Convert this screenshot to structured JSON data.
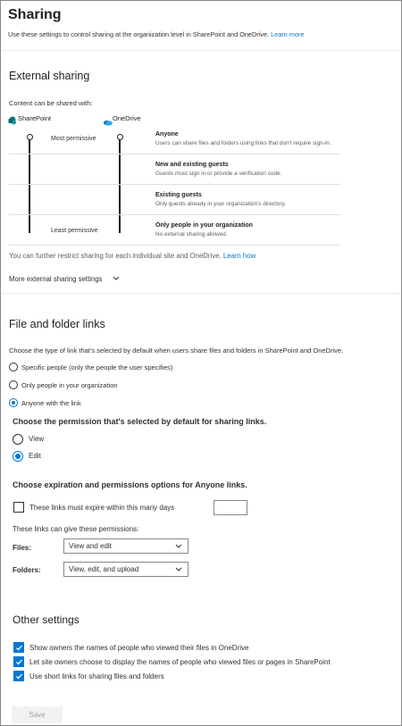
{
  "header": {
    "title": "Sharing",
    "subtitle": "Use these settings to control sharing at the organization level in SharePoint and OneDrive.",
    "learn_more": "Learn more"
  },
  "external": {
    "title": "External sharing",
    "intro": "Content can be shared with:",
    "sharepoint_label": "SharePoint",
    "onedrive_label": "OneDrive",
    "most_permissive": "Most permissive",
    "least_permissive": "Least permissive",
    "sharepoint_level": "Anyone",
    "onedrive_level": "Anyone",
    "levels": [
      {
        "title": "Anyone",
        "desc": "Users can share files and folders using links that don't require sign-in."
      },
      {
        "title": "New and existing guests",
        "desc": "Guests must sign in or provide a verification code."
      },
      {
        "title": "Existing guests",
        "desc": "Only guests already in your organization's directory."
      },
      {
        "title": "Only people in your organization",
        "desc": "No external sharing allowed."
      }
    ],
    "restrict_text": "You can further restrict sharing for each individual site and OneDrive.",
    "learn_how": "Learn how",
    "more_settings": "More external sharing settings"
  },
  "links": {
    "title": "File and folder links",
    "intro": "Choose the type of link that's selected by default when users share files and folders in SharePoint and OneDrive.",
    "options": [
      {
        "label": "Specific people (only the people the user specifies)",
        "selected": false
      },
      {
        "label": "Only people in your organization",
        "selected": false
      },
      {
        "label": "Anyone with the link",
        "selected": true
      }
    ],
    "permission_heading": "Choose the permission that's selected by default for sharing links.",
    "permission_options": [
      {
        "label": "View",
        "selected": false
      },
      {
        "label": "Edit",
        "selected": true
      }
    ],
    "expiration_heading": "Choose expiration and permissions options for Anyone links.",
    "expire_label": "These links must expire within this many days",
    "expire_checked": false,
    "expire_value": "",
    "permissions_caption": "These links can give these permissions:",
    "files_label": "Files:",
    "files_value": "View and edit",
    "folders_label": "Folders:",
    "folders_value": "View, edit, and upload"
  },
  "other": {
    "title": "Other settings",
    "items": [
      {
        "label": "Show owners the names of people who viewed their files in OneDrive",
        "checked": true
      },
      {
        "label": "Let site owners choose to display the names of people who viewed files or pages in SharePoint",
        "checked": true
      },
      {
        "label": "Use short links for sharing files and folders",
        "checked": true
      }
    ]
  },
  "footer": {
    "save_label": "Save"
  },
  "colors": {
    "accent": "#0078d4",
    "sharepoint_brand": "#03787c",
    "onedrive_brand": "#0364b8"
  }
}
